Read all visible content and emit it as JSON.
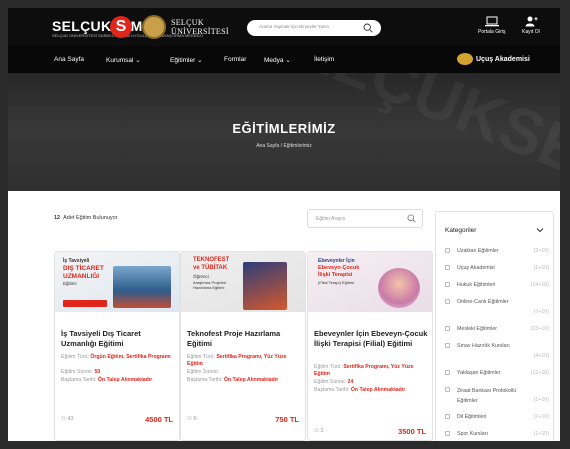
{
  "header": {
    "logo_text": "SELÇUKSEM",
    "logo_sub": "SELÇUK ÜNİVERSİTESİ SÜREKLİ EĞİTİM UYGULAMA VE ARAŞTIRMA MERKEZİ",
    "logo_mark": "S",
    "university_line1": "SELÇUK",
    "university_line2": "ÜNİVERSİTESİ",
    "search_placeholder": "Arama Yapmak İçin Birşeyler Yazın",
    "portal_label": "Portala Giriş",
    "register_label": "Kayıt Ol"
  },
  "nav": {
    "items": [
      "Ana Sayfa",
      "Kurumsal",
      "Eğitimler",
      "Formlar",
      "Medya",
      "İletişim"
    ],
    "academy_label": "Uçuş Akademisi"
  },
  "hero": {
    "watermark": "SELÇUKSEM",
    "title": "EĞİTİMLERİMİZ",
    "breadcrumb": "Ana Sayfa  /  Eğitimlerimiz"
  },
  "content": {
    "count_number": "12",
    "count_text": "Adet Eğitim Bulunuyor",
    "search_placeholder": "Eğitim Arayın"
  },
  "cards": [
    {
      "image_line1": "İş Tavsiyeli",
      "image_line2": "DIŞ TİCARET",
      "image_line3": "UZMANLIĞI",
      "image_line4": "Eğitimi",
      "title": "İş Tavsiyeli Dış Ticaret Uzmanlığı Eğitimi",
      "type_label": "Eğitim Türü:",
      "type_value": "Örgün Eğitim, Sertifika Programı",
      "duration_label": "Eğitim Süresi:",
      "duration_value": "50",
      "start_label": "Başlama Tarihi:",
      "start_value": "Ön Talep Alınmaktadır",
      "users": "43",
      "price": "4500 TL"
    },
    {
      "image_line1": "TEKNOFEST",
      "image_line2": "ve TÜBİTAK",
      "image_line3": "Öğrenci",
      "image_line4": "Araştırma Projeleri Hazırlama Eğitimi",
      "title": "Teknofest Proje Hazırlama Eğitimi",
      "type_label": "Eğitim Türü:",
      "type_value": "Sertifika Programı, Yüz Yüze Eğitim",
      "duration_label": "Eğitim Süresi:",
      "duration_value": "",
      "start_label": "Başlama Tarihi:",
      "start_value": "Ön Talep Alınmaktadır",
      "users": "5",
      "price": "750 TL"
    },
    {
      "image_line1": "Ebeveynler İçin",
      "image_line2": "Ebeveyn-Çocuk",
      "image_line3": "İlişki Terapisi",
      "image_line4": "(Filial Terapi) Eğitimi",
      "title": "Ebeveynler İçin Ebeveyn-Çocuk İlişki Terapisi (Filial) Eğitimi",
      "type_label": "Eğitim Türü:",
      "type_value": "Sertifika Programı, Yüz Yüze Eğitim",
      "duration_label": "Eğitim Süresi:",
      "duration_value": "24",
      "start_label": "Başlama Tarihi:",
      "start_value": "Ön Talep Alınmaktadır",
      "users": "2",
      "price": "3500 TL"
    }
  ],
  "sidebar": {
    "title": "Kategoriler",
    "categories": [
      {
        "label": "Uzaktan Eğitimler",
        "count": "(2+10)"
      },
      {
        "label": "Uçuş Akademisi",
        "count": "(1+10)"
      },
      {
        "label": "Hukuk Eğitimleri",
        "count": "(14+10)"
      },
      {
        "label": "Online-Canlı Eğitimler",
        "count": "(7+10)"
      },
      {
        "label": "Mesleki Eğitimler",
        "count": "(13+10)"
      },
      {
        "label": "Sınav Hazırlık Kursları",
        "count": "(4+10)"
      },
      {
        "label": "Yaklaşan Eğitimler",
        "count": "(12+10)"
      },
      {
        "label": "Ziraat Bankası Protokollü Eğitimler",
        "count": "(1+10)"
      },
      {
        "label": "Dil Eğitimleri",
        "count": "(2+10)"
      },
      {
        "label": "Spor Kursları",
        "count": "(1+10)"
      }
    ]
  },
  "colors": {
    "brand_red": "#e0261b",
    "dark": "#0d0d0d",
    "gold": "#d4a431"
  }
}
